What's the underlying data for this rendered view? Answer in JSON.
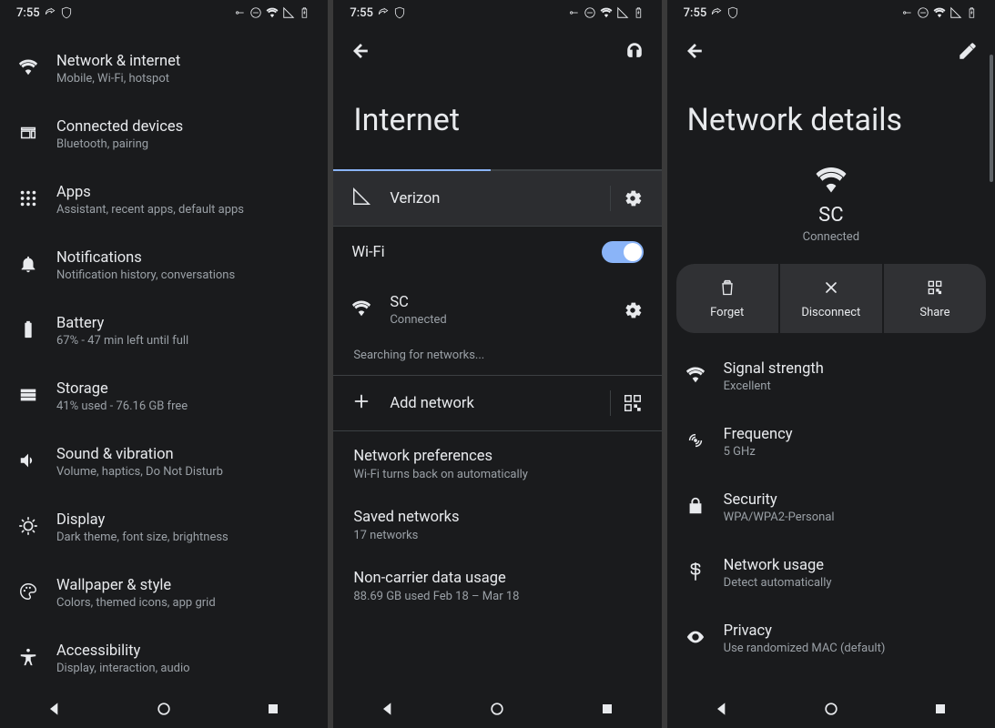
{
  "status": {
    "time": "7:55"
  },
  "screen1": {
    "items": [
      {
        "title": "Network & internet",
        "subtitle": "Mobile, Wi-Fi, hotspot",
        "icon": "wifi"
      },
      {
        "title": "Connected devices",
        "subtitle": "Bluetooth, pairing",
        "icon": "devices"
      },
      {
        "title": "Apps",
        "subtitle": "Assistant, recent apps, default apps",
        "icon": "apps"
      },
      {
        "title": "Notifications",
        "subtitle": "Notification history, conversations",
        "icon": "bell"
      },
      {
        "title": "Battery",
        "subtitle": "67% - 47 min left until full",
        "icon": "battery"
      },
      {
        "title": "Storage",
        "subtitle": "41% used - 76.16 GB free",
        "icon": "storage"
      },
      {
        "title": "Sound & vibration",
        "subtitle": "Volume, haptics, Do Not Disturb",
        "icon": "sound"
      },
      {
        "title": "Display",
        "subtitle": "Dark theme, font size, brightness",
        "icon": "display"
      },
      {
        "title": "Wallpaper & style",
        "subtitle": "Colors, themed icons, app grid",
        "icon": "palette"
      },
      {
        "title": "Accessibility",
        "subtitle": "Display, interaction, audio",
        "icon": "accessibility"
      }
    ]
  },
  "screen2": {
    "page_title": "Internet",
    "carrier": "Verizon",
    "wifi_label": "Wi-Fi",
    "network": {
      "ssid": "SC",
      "status": "Connected"
    },
    "searching": "Searching for networks...",
    "add_network": "Add network",
    "prefs": {
      "title": "Network preferences",
      "subtitle": "Wi-Fi turns back on automatically"
    },
    "saved": {
      "title": "Saved networks",
      "subtitle": "17 networks"
    },
    "usage": {
      "title": "Non-carrier data usage",
      "subtitle": "88.69 GB used Feb 18 – Mar 18"
    }
  },
  "screen3": {
    "page_title": "Network details",
    "ssid": "SC",
    "status": "Connected",
    "actions": {
      "forget": "Forget",
      "disconnect": "Disconnect",
      "share": "Share"
    },
    "details": [
      {
        "title": "Signal strength",
        "subtitle": "Excellent",
        "icon": "wifi"
      },
      {
        "title": "Frequency",
        "subtitle": "5 GHz",
        "icon": "broadcast"
      },
      {
        "title": "Security",
        "subtitle": "WPA/WPA2-Personal",
        "icon": "lock"
      },
      {
        "title": "Network usage",
        "subtitle": "Detect automatically",
        "icon": "dollar"
      },
      {
        "title": "Privacy",
        "subtitle": "Use randomized MAC (default)",
        "icon": "eye"
      }
    ]
  }
}
